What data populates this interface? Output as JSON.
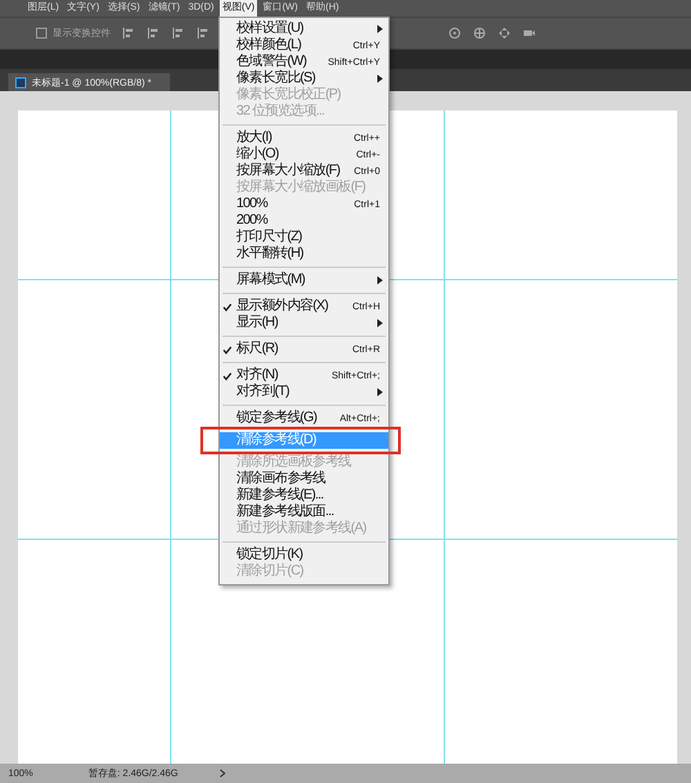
{
  "menubar": [
    {
      "label": "图层(L)",
      "selected": false
    },
    {
      "label": "文字(Y)",
      "selected": false
    },
    {
      "label": "选择(S)",
      "selected": false
    },
    {
      "label": "滤镜(T)",
      "selected": false
    },
    {
      "label": "3D(D)",
      "selected": false
    },
    {
      "label": "视图(V)",
      "selected": true
    },
    {
      "label": "窗口(W)",
      "selected": false
    },
    {
      "label": "帮助(H)",
      "selected": false
    }
  ],
  "options_bar": {
    "transform_controls": {
      "label": "显示变换控件",
      "checked": false
    }
  },
  "document_tab": {
    "title": "未标题-1 @ 100%(RGB/8) *"
  },
  "view_menu": {
    "items": [
      {
        "kind": "item",
        "label": "校样设置(U)",
        "submenu": true,
        "checked": false,
        "disabled": false,
        "selected": false
      },
      {
        "kind": "item",
        "label": "校样颜色(L)",
        "shortcut": "Ctrl+Y",
        "submenu": false,
        "checked": false,
        "disabled": false,
        "selected": false
      },
      {
        "kind": "item",
        "label": "色域警告(W)",
        "shortcut": "Shift+Ctrl+Y",
        "submenu": false,
        "checked": false,
        "disabled": false,
        "selected": false
      },
      {
        "kind": "item",
        "label": "像素长宽比(S)",
        "submenu": true,
        "checked": false,
        "disabled": false,
        "selected": false
      },
      {
        "kind": "item",
        "label": "像素长宽比校正(P)",
        "submenu": false,
        "checked": false,
        "disabled": true,
        "selected": false
      },
      {
        "kind": "item",
        "label": "32 位预览选项...",
        "submenu": false,
        "checked": false,
        "disabled": true,
        "selected": false
      },
      {
        "kind": "separator"
      },
      {
        "kind": "item",
        "label": "放大(I)",
        "shortcut": "Ctrl++",
        "submenu": false,
        "checked": false,
        "disabled": false,
        "selected": false
      },
      {
        "kind": "item",
        "label": "缩小(O)",
        "shortcut": "Ctrl+-",
        "submenu": false,
        "checked": false,
        "disabled": false,
        "selected": false
      },
      {
        "kind": "item",
        "label": "按屏幕大小缩放(F)",
        "shortcut": "Ctrl+0",
        "submenu": false,
        "checked": false,
        "disabled": false,
        "selected": false
      },
      {
        "kind": "item",
        "label": "按屏幕大小缩放画板(F)",
        "submenu": false,
        "checked": false,
        "disabled": true,
        "selected": false
      },
      {
        "kind": "item",
        "label": "100%",
        "shortcut": "Ctrl+1",
        "submenu": false,
        "checked": false,
        "disabled": false,
        "selected": false
      },
      {
        "kind": "item",
        "label": "200%",
        "submenu": false,
        "checked": false,
        "disabled": false,
        "selected": false
      },
      {
        "kind": "item",
        "label": "打印尺寸(Z)",
        "submenu": false,
        "checked": false,
        "disabled": false,
        "selected": false
      },
      {
        "kind": "item",
        "label": "水平翻转(H)",
        "submenu": false,
        "checked": false,
        "disabled": false,
        "selected": false
      },
      {
        "kind": "separator"
      },
      {
        "kind": "item",
        "label": "屏幕模式(M)",
        "submenu": true,
        "checked": false,
        "disabled": false,
        "selected": false
      },
      {
        "kind": "separator"
      },
      {
        "kind": "item",
        "label": "显示额外内容(X)",
        "shortcut": "Ctrl+H",
        "submenu": false,
        "checked": true,
        "disabled": false,
        "selected": false
      },
      {
        "kind": "item",
        "label": "显示(H)",
        "submenu": true,
        "checked": false,
        "disabled": false,
        "selected": false
      },
      {
        "kind": "separator"
      },
      {
        "kind": "item",
        "label": "标尺(R)",
        "shortcut": "Ctrl+R",
        "submenu": false,
        "checked": true,
        "disabled": false,
        "selected": false
      },
      {
        "kind": "separator"
      },
      {
        "kind": "item",
        "label": "对齐(N)",
        "shortcut": "Shift+Ctrl+;",
        "submenu": false,
        "checked": true,
        "disabled": false,
        "selected": false
      },
      {
        "kind": "item",
        "label": "对齐到(T)",
        "submenu": true,
        "checked": false,
        "disabled": false,
        "selected": false
      },
      {
        "kind": "separator"
      },
      {
        "kind": "item",
        "label": "锁定参考线(G)",
        "shortcut": "Alt+Ctrl+;",
        "submenu": false,
        "checked": false,
        "disabled": false,
        "selected": false
      },
      {
        "kind": "item",
        "label": "清除参考线(D)",
        "submenu": false,
        "checked": false,
        "disabled": false,
        "selected": true
      },
      {
        "kind": "item",
        "label": "清除所选画板参考线",
        "submenu": false,
        "checked": false,
        "disabled": true,
        "selected": false
      },
      {
        "kind": "item",
        "label": "清除画布参考线",
        "submenu": false,
        "checked": false,
        "disabled": false,
        "selected": false
      },
      {
        "kind": "item",
        "label": "新建参考线(E)...",
        "submenu": false,
        "checked": false,
        "disabled": false,
        "selected": false
      },
      {
        "kind": "item",
        "label": "新建参考线版面...",
        "submenu": false,
        "checked": false,
        "disabled": false,
        "selected": false
      },
      {
        "kind": "item",
        "label": "通过形状新建参考线(A)",
        "submenu": false,
        "checked": false,
        "disabled": true,
        "selected": false
      },
      {
        "kind": "separator"
      },
      {
        "kind": "item",
        "label": "锁定切片(K)",
        "submenu": false,
        "checked": false,
        "disabled": false,
        "selected": false
      },
      {
        "kind": "item",
        "label": "清除切片(C)",
        "submenu": false,
        "checked": false,
        "disabled": true,
        "selected": false
      }
    ]
  },
  "status_bar": {
    "zoom": "100%",
    "scratch": "暂存盘: 2.46G/2.46G"
  }
}
